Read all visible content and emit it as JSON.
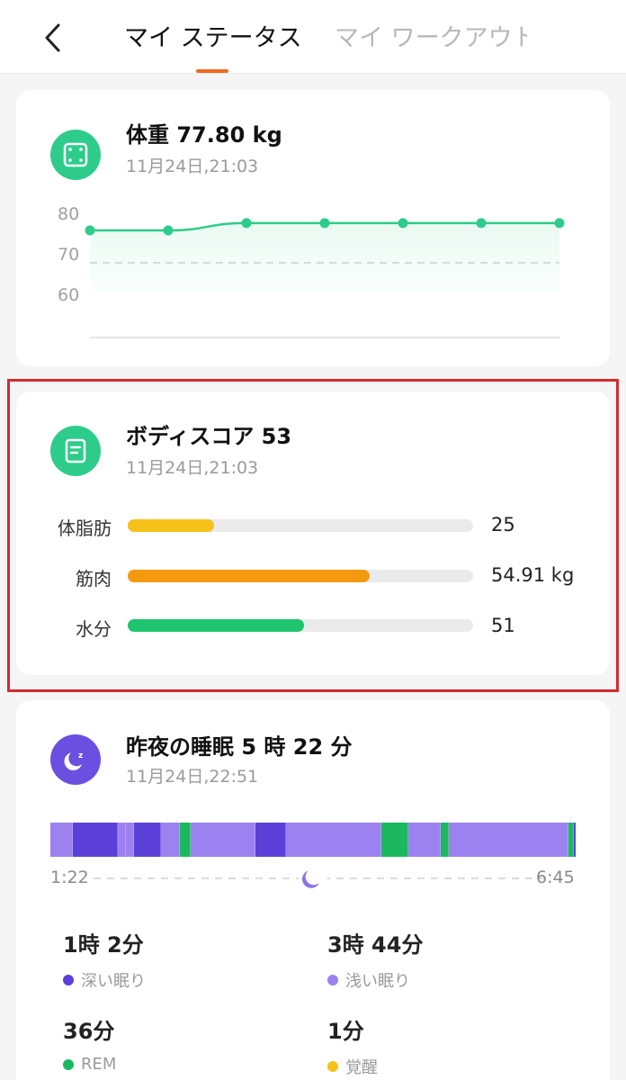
{
  "header": {
    "tab_active": "マイ ステータス",
    "tab_inactive": "マイ ワークアウト"
  },
  "weight_card": {
    "title": "体重 77.80 kg",
    "timestamp": "11月24日,21:03",
    "icon": "scale-icon",
    "color": "#2ecc8a",
    "y_ticks": [
      "80",
      "70",
      "60"
    ]
  },
  "chart_data": {
    "type": "line",
    "title": "",
    "xlabel": "",
    "ylabel": "",
    "ylim": [
      55,
      85
    ],
    "y_ticks": [
      80,
      70,
      60
    ],
    "reference_line": 68,
    "series": [
      {
        "values": [
          76,
          76,
          77.8,
          77.8,
          77.8,
          77.8,
          77.8
        ]
      }
    ]
  },
  "body_score_card": {
    "title": "ボディスコア 53",
    "timestamp": "11月24日,21:03",
    "icon": "document-icon",
    "color": "#2ecc8a",
    "metrics": [
      {
        "label": "体脂肪",
        "value": "25",
        "fill": 0.25,
        "color": "#f6c21a"
      },
      {
        "label": "筋肉",
        "value": "54.91 kg",
        "fill": 0.7,
        "color": "#f39a10"
      },
      {
        "label": "水分",
        "value": "51",
        "fill": 0.51,
        "color": "#1ec46e"
      }
    ]
  },
  "sleep_card": {
    "title": "昨夜の睡眠 5 時 22 分",
    "timestamp": "11月24日,22:51",
    "icon": "moon-icon",
    "color": "#6b4fe0",
    "start_time": "1:22",
    "end_time": "6:45",
    "stats": [
      {
        "value": "1時 2分",
        "label": "深い眠り",
        "color": "#5b3fd9"
      },
      {
        "value": "3時 44分",
        "label": "浅い眠り",
        "color": "#9b82f0"
      },
      {
        "value": "36分",
        "label": "REM",
        "color": "#1bb85f"
      },
      {
        "value": "1分",
        "label": "覚醒",
        "color": "#f6c21a"
      }
    ],
    "segments": [
      {
        "stage": "light",
        "frac": 0.043
      },
      {
        "stage": "deep",
        "frac": 0.086
      },
      {
        "stage": "light",
        "frac": 0.014
      },
      {
        "stage": "light",
        "frac": 0.017
      },
      {
        "stage": "deep",
        "frac": 0.051
      },
      {
        "stage": "light",
        "frac": 0.036
      },
      {
        "stage": "rem",
        "frac": 0.021
      },
      {
        "stage": "light",
        "frac": 0.122
      },
      {
        "stage": "deep",
        "frac": 0.058
      },
      {
        "stage": "light",
        "frac": 0.183
      },
      {
        "stage": "rem",
        "frac": 0.051
      },
      {
        "stage": "light",
        "frac": 0.062
      },
      {
        "stage": "rem",
        "frac": 0.015
      },
      {
        "stage": "light",
        "frac": 0.228
      },
      {
        "stage": "rem",
        "frac": 0.009
      },
      {
        "stage": "deep",
        "frac": 0.009
      }
    ],
    "stage_colors": {
      "deep": "#5b3fd9",
      "light": "#9b82f0",
      "rem": "#1bb85f"
    }
  }
}
